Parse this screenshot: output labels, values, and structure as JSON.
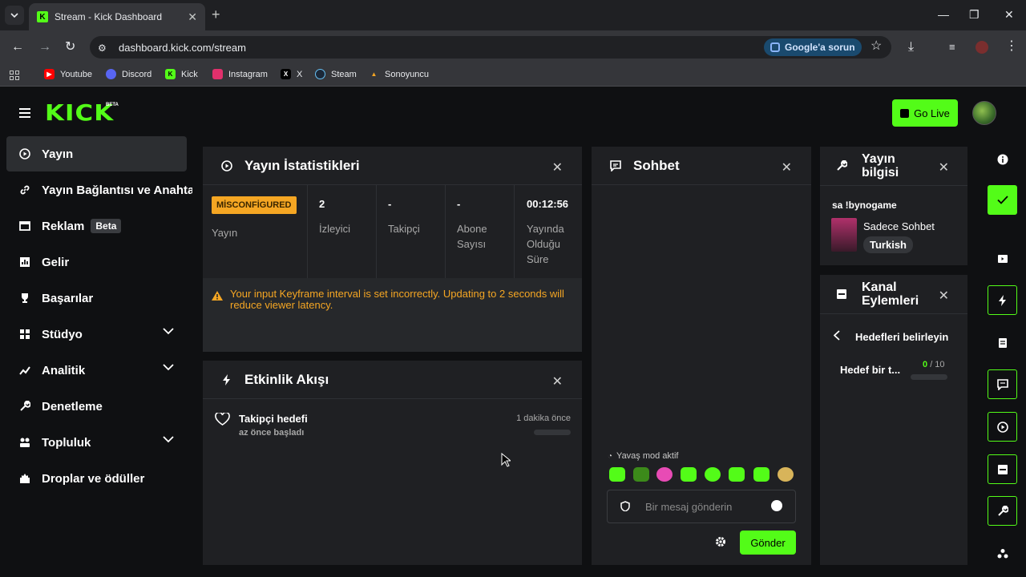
{
  "browser": {
    "tab_title": "Stream - Kick Dashboard",
    "url": "dashboard.kick.com/stream",
    "google_ask": "Google'a sorun",
    "bookmarks": [
      {
        "label": "Youtube",
        "color": "#ff0000"
      },
      {
        "label": "Discord",
        "color": "#5865f2"
      },
      {
        "label": "Kick",
        "color": "#53fc18"
      },
      {
        "label": "Instagram",
        "color": "#e1306c"
      },
      {
        "label": "X",
        "color": "#000000"
      },
      {
        "label": "Steam",
        "color": "#1b2838"
      },
      {
        "label": "Sonoyuncu",
        "color": "#f5a623"
      }
    ]
  },
  "header": {
    "logo": "KICK",
    "logo_badge": "BETA",
    "go_live": "Go Live"
  },
  "sidebar": {
    "items": [
      {
        "label": "Yayın",
        "icon": "play-circle-icon",
        "active": true
      },
      {
        "label": "Yayın Bağlantısı ve Anahtarı",
        "icon": "link-icon"
      },
      {
        "label": "Reklam",
        "icon": "ad-icon",
        "badge": "Beta"
      },
      {
        "label": "Gelir",
        "icon": "chart-icon"
      },
      {
        "label": "Başarılar",
        "icon": "trophy-icon"
      },
      {
        "label": "Stüdyo",
        "icon": "studio-icon",
        "expandable": true
      },
      {
        "label": "Analitik",
        "icon": "analytics-icon",
        "expandable": true
      },
      {
        "label": "Denetleme",
        "icon": "wrench-icon"
      },
      {
        "label": "Topluluk",
        "icon": "community-icon",
        "expandable": true
      },
      {
        "label": "Droplar ve ödüller",
        "icon": "gift-icon"
      }
    ]
  },
  "stats": {
    "title": "Yayın İstatistikleri",
    "status_badge": "MİSCONFİGURED",
    "status_label": "Yayın",
    "viewers_value": "2",
    "viewers_label": "İzleyici",
    "followers_value": "-",
    "followers_label": "Takipçi",
    "subs_value": "-",
    "subs_label": "Abone Sayısı",
    "uptime_value": "00:12:56",
    "uptime_label": "Yayında Olduğu Süre",
    "warning": "Your input Keyframe interval is set incorrectly. Updating to 2 seconds will reduce viewer latency."
  },
  "activity": {
    "title": "Etkinlik Akışı",
    "event_title": "Takipçi hedefi",
    "event_sub": "az önce başladı",
    "event_time": "1 dakika önce"
  },
  "chat": {
    "title": "Sohbet",
    "slow_mode": "Yavaş mod aktif",
    "placeholder": "Bir mesaj gönderin",
    "send": "Gönder"
  },
  "stream_info": {
    "title": "Yayın bilgisi",
    "stream_title": "sa !bynogame",
    "category": "Sadece Sohbet",
    "language": "Turkish"
  },
  "channel_actions": {
    "title": "Kanal Eylemleri",
    "subtitle": "Hedefleri belirleyin",
    "goal_label": "Hedef bir t...",
    "goal_current": "0",
    "goal_total": "/ 10",
    "goal_progress": 0
  },
  "colors": {
    "brand": "#53fc18",
    "warning": "#f5a623",
    "panel": "#1f2023"
  }
}
